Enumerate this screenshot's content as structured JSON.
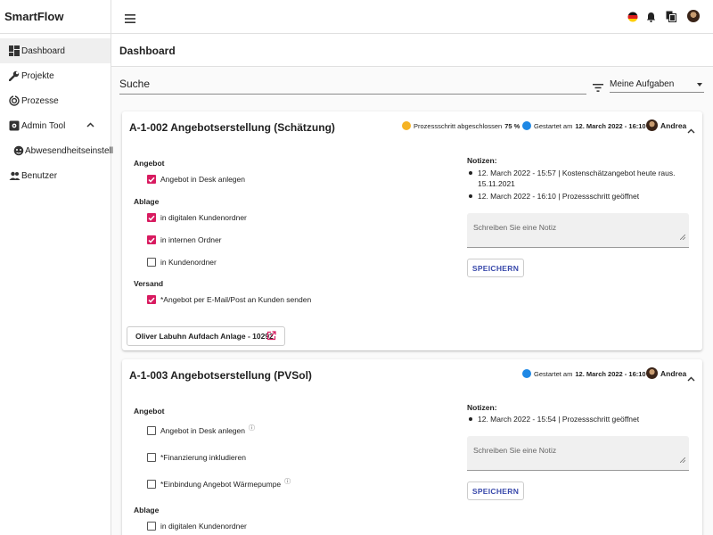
{
  "app": {
    "title": "SmartFlow"
  },
  "sidebar": {
    "items": [
      {
        "label": "Dashboard",
        "icon": "dashboard-icon"
      },
      {
        "label": "Projekte",
        "icon": "wrench-icon"
      },
      {
        "label": "Prozesse",
        "icon": "process-icon"
      },
      {
        "label": "Admin Tool",
        "icon": "admin-icon"
      },
      {
        "label": "Abwesendheitseinstell",
        "icon": "absence-icon"
      },
      {
        "label": "Benutzer",
        "icon": "users-icon"
      }
    ]
  },
  "page": {
    "title": "Dashboard"
  },
  "search": {
    "value": "Suche"
  },
  "filter": {
    "selected": "Meine Aufgaben"
  },
  "colors": {
    "accent": "#d81b60",
    "primary": "#3949ab",
    "progress": "#f5b324",
    "started": "#1e88e5"
  },
  "cards": [
    {
      "title": "A-1-002 Angebotserstellung (Schätzung)",
      "progress_label": "Prozessschritt abgeschlossen",
      "progress_value": "75 %",
      "started_label": "Gestartet am",
      "started_value": "12. March 2022 - 16:10",
      "user": "Andrea",
      "sections": [
        {
          "title": "Angebot",
          "items": [
            {
              "label": "Angebot in Desk anlegen",
              "checked": true
            }
          ]
        },
        {
          "title": "Ablage",
          "items": [
            {
              "label": "in digitalen Kundenordner",
              "checked": true
            },
            {
              "label": "in internen Ordner",
              "checked": true
            },
            {
              "label": "in Kundenordner",
              "checked": false
            }
          ]
        },
        {
          "title": "Versand",
          "items": [
            {
              "label": "*Angebot per E-Mail/Post an Kunden senden",
              "checked": true
            }
          ]
        }
      ],
      "notes_label": "Notizen:",
      "notes": [
        "12. March 2022 - 15:57 | Kostenschätzangebot heute raus. 15.11.2021",
        "12. March 2022 - 16:10 | Prozessschritt geöffnet"
      ],
      "note_placeholder": "Schreiben Sie eine Notiz",
      "save_label": "SPEICHERN",
      "link_label": "Oliver Labuhn Aufdach Anlage - 10292"
    },
    {
      "title": "A-1-003 Angebotserstellung (PVSol)",
      "started_label": "Gestartet am",
      "started_value": "12. March 2022 - 16:10",
      "user": "Andrea",
      "sections": [
        {
          "title": "Angebot",
          "items": [
            {
              "label": "Angebot in Desk anlegen",
              "checked": false
            },
            {
              "label": "*Finanzierung inkludieren",
              "checked": false
            },
            {
              "label": "*Einbindung Angebot Wärmepumpe",
              "checked": false
            }
          ]
        },
        {
          "title": "Ablage",
          "items": [
            {
              "label": "in digitalen Kundenordner",
              "checked": false
            }
          ]
        }
      ],
      "notes_label": "Notizen:",
      "notes": [
        "12. March 2022 - 15:54 | Prozessschritt geöffnet"
      ],
      "note_placeholder": "Schreiben Sie eine Notiz",
      "save_label": "SPEICHERN"
    }
  ]
}
